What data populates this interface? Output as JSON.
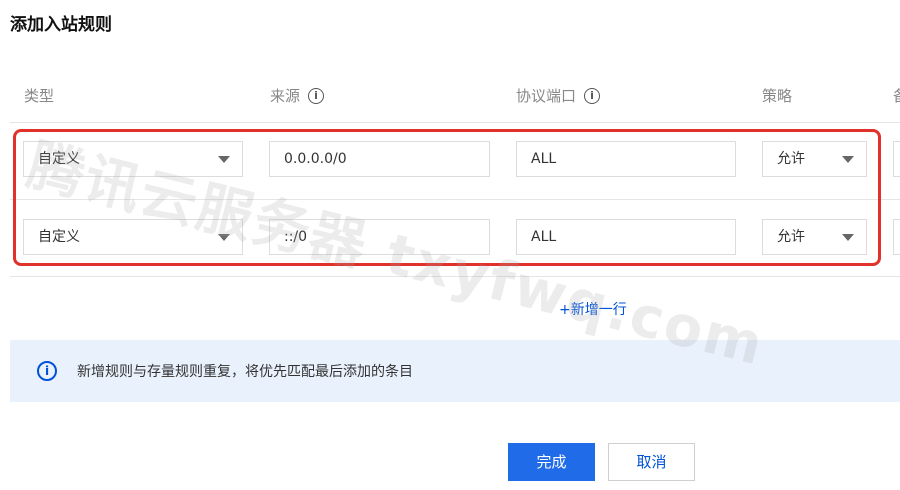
{
  "dialog": {
    "title": "添加入站规则"
  },
  "table": {
    "headers": {
      "type": "类型",
      "source": "来源",
      "port": "协议端口",
      "policy": "策略",
      "remark_partial": "备"
    },
    "rows": [
      {
        "type": "自定义",
        "source": "0.0.0.0/0",
        "port": "ALL",
        "policy": "允许"
      },
      {
        "type": "自定义",
        "source": "::/0",
        "port": "ALL",
        "policy": "允许"
      }
    ]
  },
  "actions": {
    "add_row": "+新增一行",
    "confirm": "完成",
    "cancel": "取消"
  },
  "notice": {
    "text": "新增规则与存量规则重复，将优先匹配最后添加的条目"
  },
  "watermark": {
    "text": "腾讯云服务器 txyfwq.com"
  },
  "colors": {
    "accent": "#0052d9",
    "highlight": "#e0312b",
    "notice_bg": "#e9f1fd"
  },
  "icons": {
    "info": "info-circle-icon",
    "dropdown": "chevron-down-icon"
  }
}
